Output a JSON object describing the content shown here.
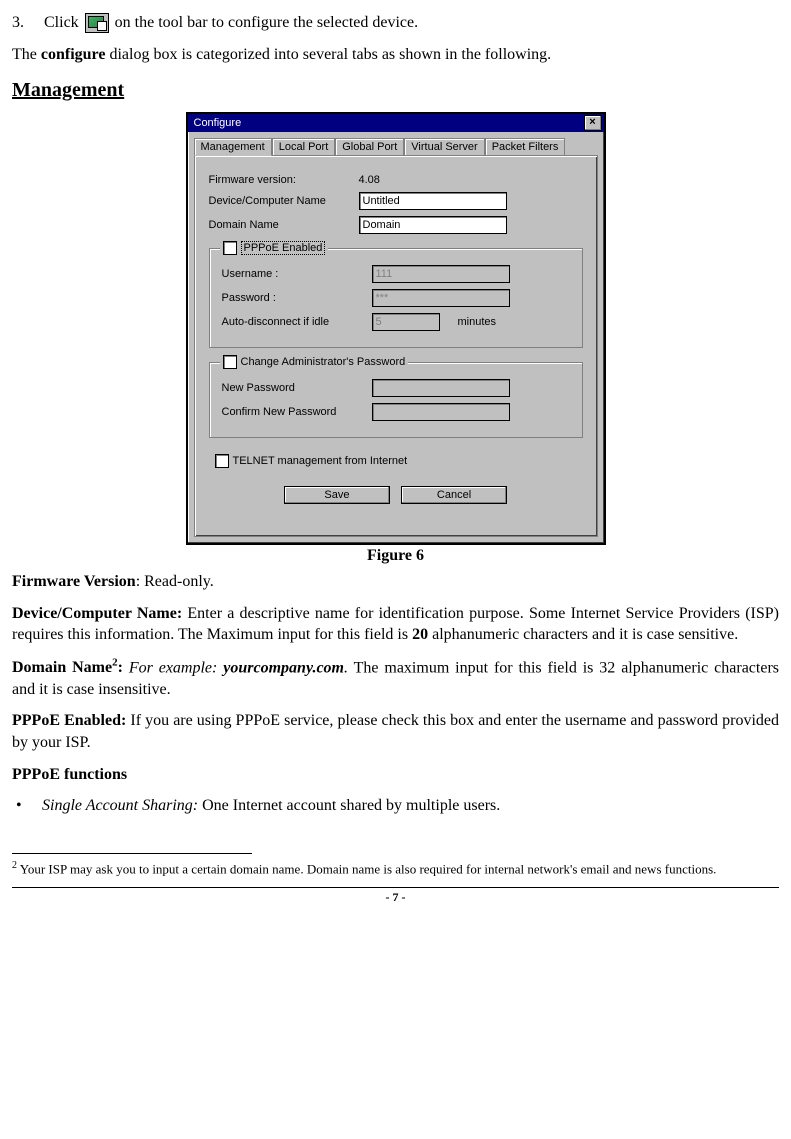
{
  "step": {
    "num": "3.",
    "before": "Click",
    "after": "on the tool bar to configure the selected device."
  },
  "intro": {
    "pre": "The ",
    "bold": "configure",
    "post": " dialog box is categorized into several tabs as shown in the following."
  },
  "section_heading": "Management",
  "dialog": {
    "title": "Configure",
    "close": "×",
    "tabs": [
      "Management",
      "Local Port",
      "Global Port",
      "Virtual Server",
      "Packet Filters"
    ],
    "firmware_label": "Firmware version:",
    "firmware_value": "4.08",
    "device_label": "Device/Computer Name",
    "device_value": "Untitled",
    "domain_label": "Domain Name",
    "domain_value": "Domain",
    "pppoe_check": "PPPoE Enabled",
    "username_label": "Username :",
    "username_value": "111",
    "password_label": "Password :",
    "password_value": "***",
    "idle_label": "Auto-disconnect if idle",
    "idle_value": "5",
    "idle_unit": "minutes",
    "chpw_check": "Change Administrator's Password",
    "newpw_label": "New Password",
    "confirmpw_label": "Confirm New Password",
    "telnet_check": "TELNET management from Internet",
    "save": "Save",
    "cancel": "Cancel"
  },
  "figure_caption": "Figure 6",
  "para_fw": {
    "bold": "Firmware Version",
    "rest": ": Read-only."
  },
  "para_dev": {
    "bold": "Device/Computer Name:",
    "t1": " Enter a descriptive name for identification purpose. Some Internet Service Providers (ISP) requires this information. The Maximum input for this field is ",
    "num": "20",
    "t2": " alphanumeric characters and it is case sensitive."
  },
  "para_dom": {
    "bold": "Domain Name",
    "sup": "2",
    "colon": ":",
    "it1": " For example: ",
    "itb": "yourcompany.com",
    "it2": ".",
    "rest": " The maximum input for this field is 32 alphanumeric characters and it is case insensitive."
  },
  "para_pppoe": {
    "bold": "PPPoE Enabled:",
    "rest": " If you are using PPPoE service, please check this box and enter the username and password provided by your ISP."
  },
  "para_func_heading": "PPPoE functions",
  "bullet1": {
    "it": "Single Account Sharing:",
    "rest": " One Internet account shared by multiple users."
  },
  "footnote": {
    "sup": "2",
    "text": " Your ISP may ask you to input a certain domain name. Domain name is also required for internal network's email and news functions."
  },
  "page_number": "- 7 -"
}
